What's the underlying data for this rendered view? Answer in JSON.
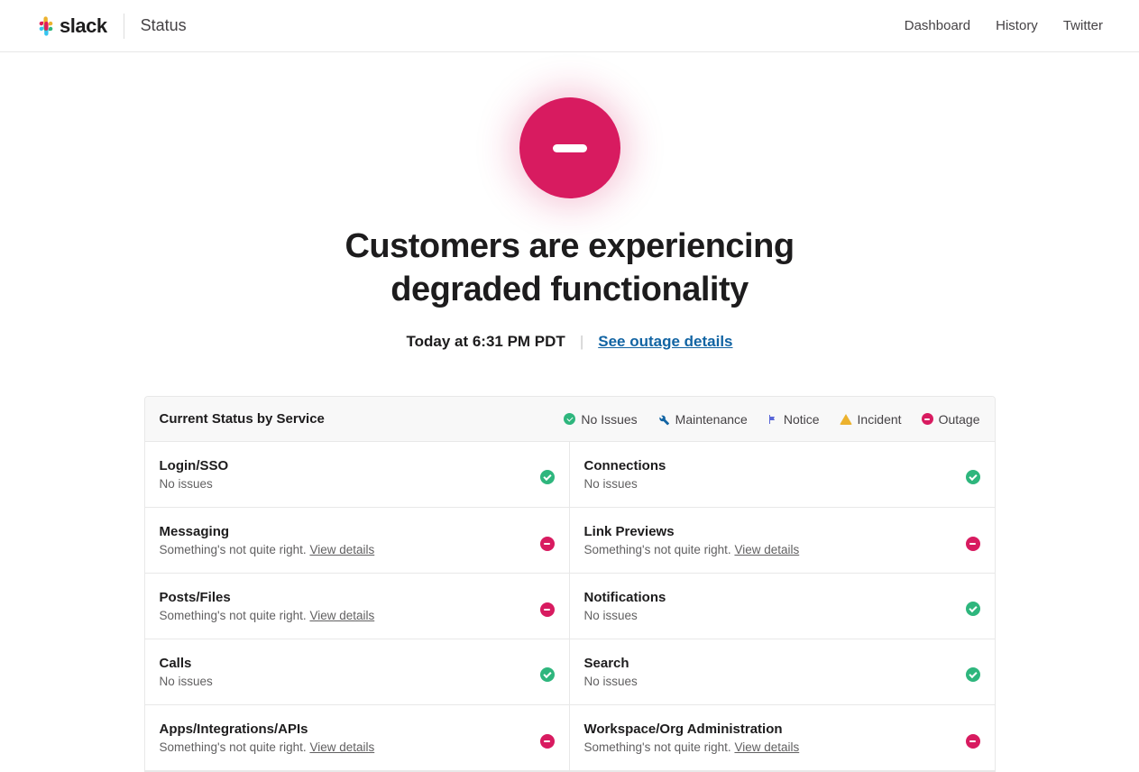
{
  "header": {
    "brand": "slack",
    "section": "Status",
    "nav": [
      {
        "label": "Dashboard"
      },
      {
        "label": "History"
      },
      {
        "label": "Twitter"
      }
    ]
  },
  "hero": {
    "title": "Customers are experiencing degraded functionality",
    "timestamp": "Today at 6:31 PM PDT",
    "link_label": "See outage details"
  },
  "panel": {
    "title": "Current Status by Service",
    "legend": [
      {
        "type": "ok",
        "label": "No Issues"
      },
      {
        "type": "maint",
        "label": "Maintenance"
      },
      {
        "type": "notice",
        "label": "Notice"
      },
      {
        "type": "incident",
        "label": "Incident"
      },
      {
        "type": "outage",
        "label": "Outage"
      }
    ]
  },
  "text": {
    "no_issues": "No issues",
    "not_right": "Something's not quite right.",
    "view_details": "View details"
  },
  "services": [
    {
      "name": "Login/SSO",
      "status": "ok"
    },
    {
      "name": "Connections",
      "status": "ok"
    },
    {
      "name": "Messaging",
      "status": "outage"
    },
    {
      "name": "Link Previews",
      "status": "outage"
    },
    {
      "name": "Posts/Files",
      "status": "outage"
    },
    {
      "name": "Notifications",
      "status": "ok"
    },
    {
      "name": "Calls",
      "status": "ok"
    },
    {
      "name": "Search",
      "status": "ok"
    },
    {
      "name": "Apps/Integrations/APIs",
      "status": "outage"
    },
    {
      "name": "Workspace/Org Administration",
      "status": "outage"
    }
  ]
}
